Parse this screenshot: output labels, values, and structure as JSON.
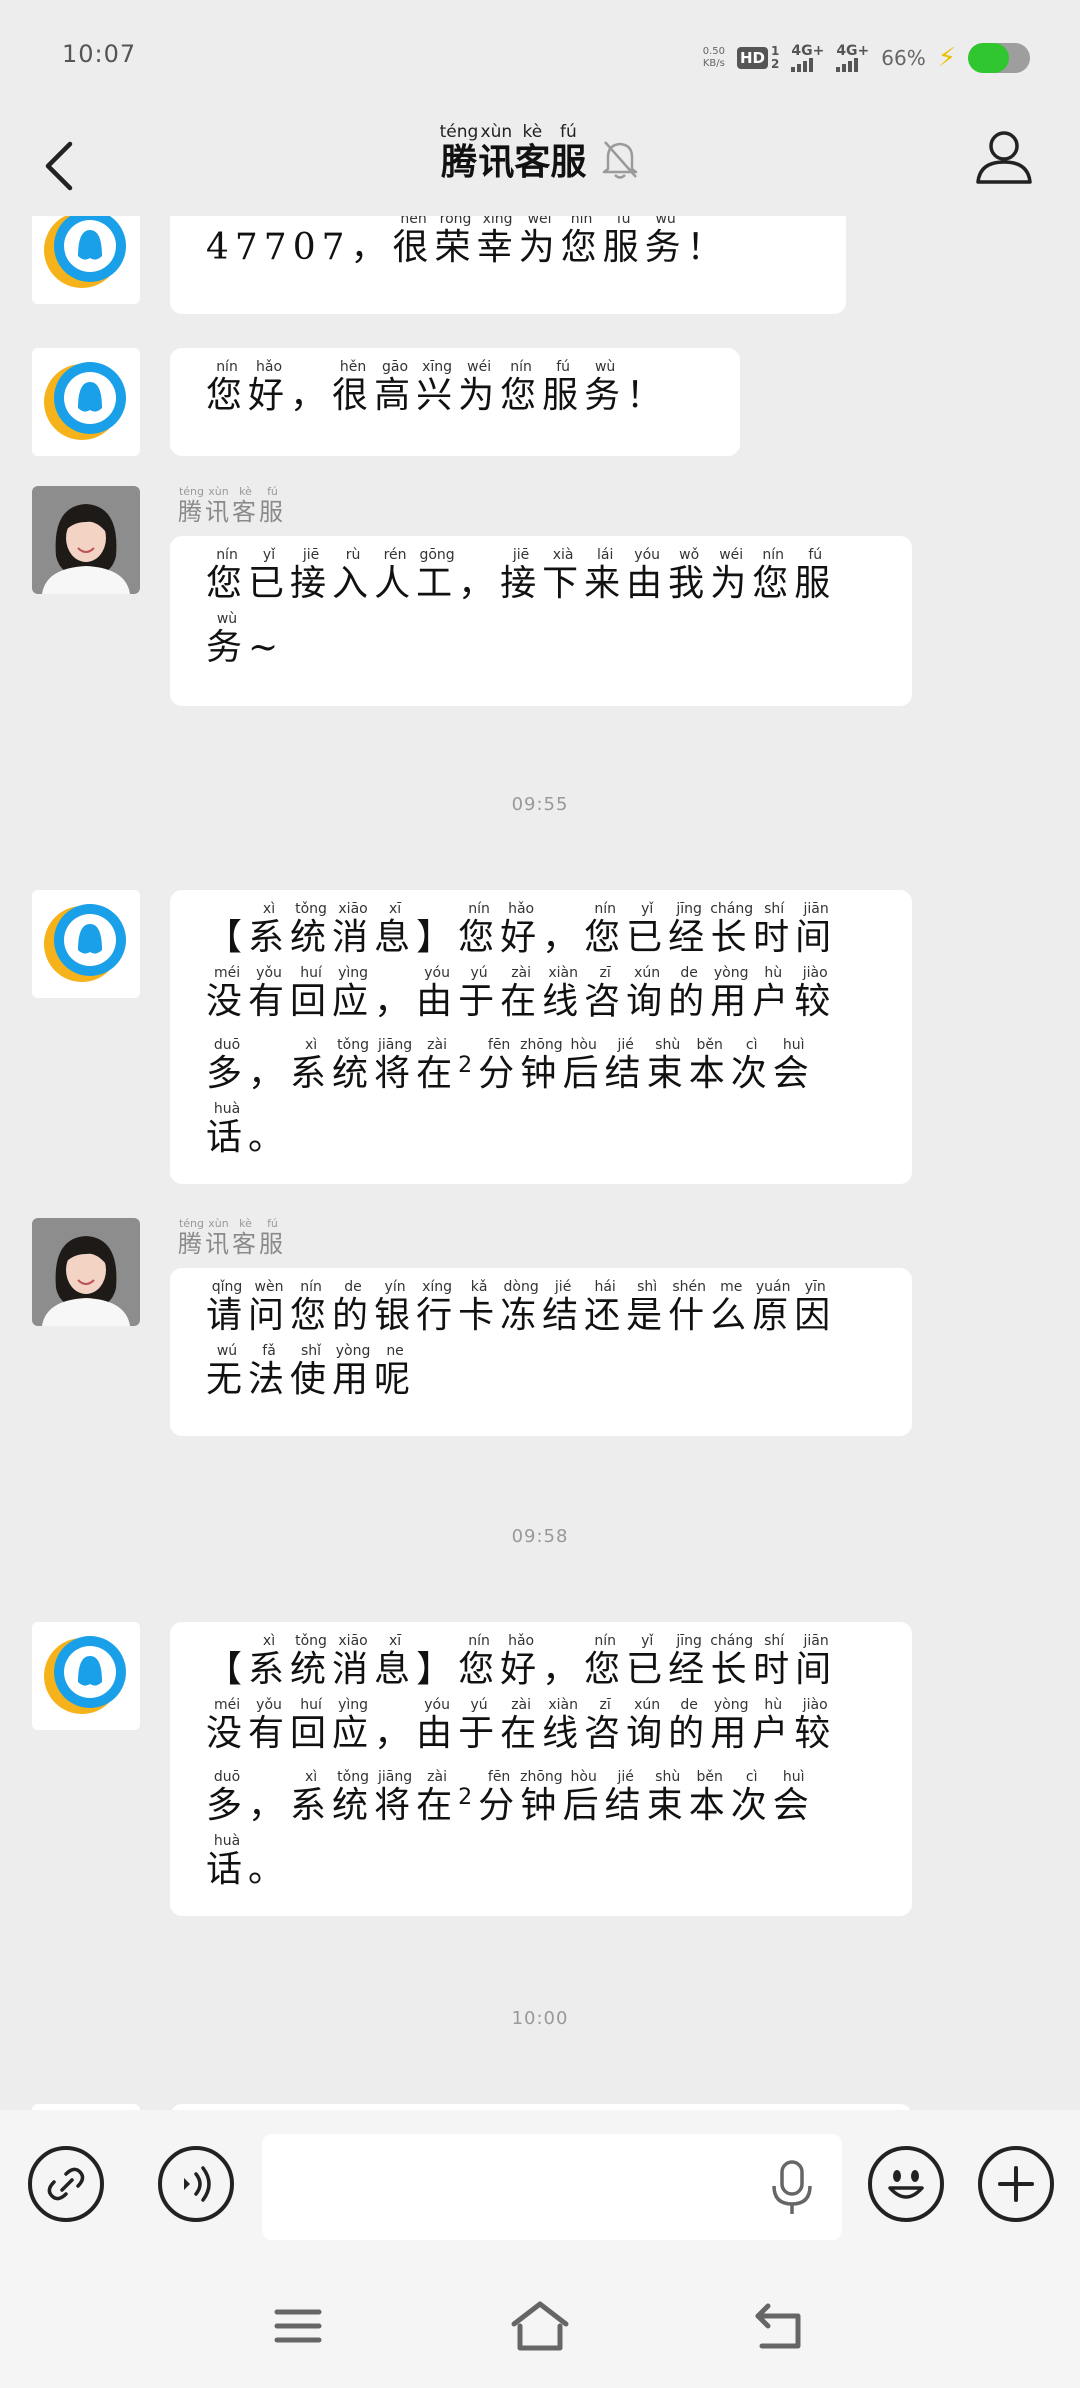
{
  "status_bar": {
    "time": "10:07",
    "net_speed_value": "0.50",
    "net_speed_unit": "KB/s",
    "hd_label": "HD",
    "hd_sim_top": "1",
    "hd_sim_bottom": "2",
    "signal_1": "4G+",
    "signal_2": "4G+",
    "battery_percent": "66%",
    "battery_level": 0.66,
    "battery_color": "#2fc62f"
  },
  "header": {
    "title_chars": [
      {
        "c": "腾",
        "py": "téng"
      },
      {
        "c": "讯",
        "py": "xùn"
      },
      {
        "c": "客",
        "py": "kè"
      },
      {
        "c": "服",
        "py": "fú"
      }
    ]
  },
  "sender_name_chars": [
    {
      "c": "腾",
      "py": "téng"
    },
    {
      "c": "讯",
      "py": "xùn"
    },
    {
      "c": "客",
      "py": "kè"
    },
    {
      "c": "服",
      "py": "fú"
    }
  ],
  "messages": {
    "m0_line2": [
      {
        "c": "47707，"
      },
      {
        "c": "很",
        "py": "hěn"
      },
      {
        "c": "荣",
        "py": "róng"
      },
      {
        "c": "幸",
        "py": "xìng"
      },
      {
        "c": "为",
        "py": "wéi"
      },
      {
        "c": "您",
        "py": "nín"
      },
      {
        "c": "服",
        "py": "fú"
      },
      {
        "c": "务",
        "py": "wù"
      },
      {
        "c": "！"
      }
    ],
    "m1": [
      {
        "c": "您",
        "py": "nín"
      },
      {
        "c": "好",
        "py": "hǎo"
      },
      {
        "c": "，"
      },
      {
        "c": "很",
        "py": "hěn"
      },
      {
        "c": "高",
        "py": "gāo"
      },
      {
        "c": "兴",
        "py": "xīng"
      },
      {
        "c": "为",
        "py": "wéi"
      },
      {
        "c": "您",
        "py": "nín"
      },
      {
        "c": "服",
        "py": "fú"
      },
      {
        "c": "务",
        "py": "wù"
      },
      {
        "c": "！"
      }
    ],
    "m2": [
      {
        "c": "您",
        "py": "nín"
      },
      {
        "c": "已",
        "py": "yǐ"
      },
      {
        "c": "接",
        "py": "jiē"
      },
      {
        "c": "入",
        "py": "rù"
      },
      {
        "c": "人",
        "py": "rén"
      },
      {
        "c": "工",
        "py": "gōng"
      },
      {
        "c": "，"
      },
      {
        "c": "接",
        "py": "jiē"
      },
      {
        "c": "下",
        "py": "xià"
      },
      {
        "c": "来",
        "py": "lái"
      },
      {
        "c": "由",
        "py": "yóu"
      },
      {
        "c": "我",
        "py": "wǒ"
      },
      {
        "c": "为",
        "py": "wéi"
      },
      {
        "c": "您",
        "py": "nín"
      },
      {
        "c": "服",
        "py": "fú"
      },
      {
        "c": "务",
        "py": "wù"
      },
      {
        "c": "~"
      }
    ],
    "sys": [
      {
        "c": "【"
      },
      {
        "c": "系",
        "py": "xì"
      },
      {
        "c": "统",
        "py": "tǒng"
      },
      {
        "c": "消",
        "py": "xiāo"
      },
      {
        "c": "息",
        "py": "xī"
      },
      {
        "c": "】"
      },
      {
        "c": "您",
        "py": "nín"
      },
      {
        "c": "好",
        "py": "hǎo"
      },
      {
        "c": "，"
      },
      {
        "c": "您",
        "py": "nín"
      },
      {
        "c": "已",
        "py": "yǐ"
      },
      {
        "c": "经",
        "py": "jīng"
      },
      {
        "c": "长",
        "py": "cháng"
      },
      {
        "c": "时",
        "py": "shí"
      },
      {
        "c": "间",
        "py": "jiān"
      },
      {
        "c": "没",
        "py": "méi"
      },
      {
        "c": "有",
        "py": "yǒu"
      },
      {
        "c": "回",
        "py": "huí"
      },
      {
        "c": "应",
        "py": "yìng"
      },
      {
        "c": "，"
      },
      {
        "c": "由",
        "py": "yóu"
      },
      {
        "c": "于",
        "py": "yú"
      },
      {
        "c": "在",
        "py": "zài"
      },
      {
        "c": "线",
        "py": "xiàn"
      },
      {
        "c": "咨",
        "py": "zī"
      },
      {
        "c": "询",
        "py": "xún"
      },
      {
        "c": "的",
        "py": "de"
      },
      {
        "c": "用",
        "py": "yòng"
      },
      {
        "c": "户",
        "py": "hù"
      },
      {
        "c": "较",
        "py": "jiào"
      },
      {
        "c": "多",
        "py": "duō"
      },
      {
        "c": "，"
      },
      {
        "c": "系",
        "py": "xì"
      },
      {
        "c": "统",
        "py": "tǒng"
      },
      {
        "c": "将",
        "py": "jiāng"
      },
      {
        "c": "在",
        "py": "zài"
      },
      {
        "c": "2",
        "sup": true
      },
      {
        "c": "分",
        "py": "fēn"
      },
      {
        "c": "钟",
        "py": "zhōng"
      },
      {
        "c": "后",
        "py": "hòu"
      },
      {
        "c": "结",
        "py": "jié"
      },
      {
        "c": "束",
        "py": "shù"
      },
      {
        "c": "本",
        "py": "běn"
      },
      {
        "c": "次",
        "py": "cì"
      },
      {
        "c": "会",
        "py": "huì"
      },
      {
        "c": "话",
        "py": "huà"
      },
      {
        "c": "。"
      }
    ],
    "m4": [
      {
        "c": "请",
        "py": "qǐng"
      },
      {
        "c": "问",
        "py": "wèn"
      },
      {
        "c": "您",
        "py": "nín"
      },
      {
        "c": "的",
        "py": "de"
      },
      {
        "c": "银",
        "py": "yín"
      },
      {
        "c": "行",
        "py": "xíng"
      },
      {
        "c": "卡",
        "py": "kǎ"
      },
      {
        "c": "冻",
        "py": "dòng"
      },
      {
        "c": "结",
        "py": "jié"
      },
      {
        "c": "还",
        "py": "hái"
      },
      {
        "c": "是",
        "py": "shì"
      },
      {
        "c": "什",
        "py": "shén"
      },
      {
        "c": "么",
        "py": "me"
      },
      {
        "c": "原",
        "py": "yuán"
      },
      {
        "c": "因",
        "py": "yīn"
      },
      {
        "c": "无",
        "py": "wú"
      },
      {
        "c": "法",
        "py": "fǎ"
      },
      {
        "c": "使",
        "py": "shǐ"
      },
      {
        "c": "用",
        "py": "yòng"
      },
      {
        "c": "呢",
        "py": "ne"
      }
    ]
  },
  "timestamps": {
    "t1": "09:55",
    "t2": "09:58",
    "t3": "10:00"
  },
  "input": {
    "placeholder": ""
  },
  "icons": {
    "back": "chevron-left-icon",
    "mute": "bell-off-icon",
    "profile": "person-icon",
    "link": "link-icon",
    "voice": "voice-icon",
    "mic": "mic-icon",
    "emoji": "emoji-icon",
    "plus": "plus-icon"
  }
}
